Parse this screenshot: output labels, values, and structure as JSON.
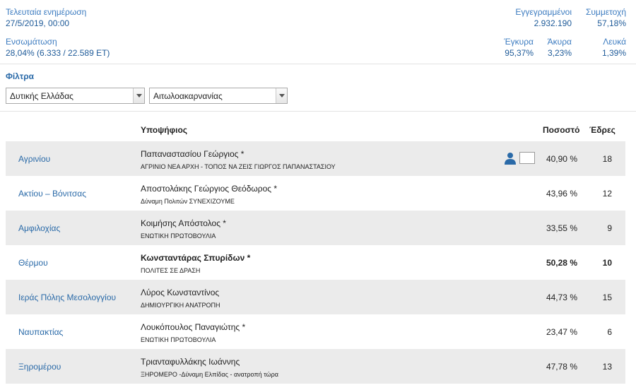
{
  "header": {
    "last_update_label": "Τελευταία ενημέρωση",
    "last_update_value": "27/5/2019, 00:00",
    "integration_label": "Ενσωμάτωση",
    "integration_value": "28,04% (6.333 / 22.589 ΕΤ)",
    "registered_label": "Εγγεγραμμένοι",
    "registered_value": "2.932.190",
    "turnout_label": "Συμμετοχή",
    "turnout_value": "57,18%",
    "valid_label": "Έγκυρα",
    "valid_value": "95,37%",
    "invalid_label": "Άκυρα",
    "invalid_value": "3,23%",
    "blank_label": "Λευκά",
    "blank_value": "1,39%"
  },
  "filters": {
    "title": "Φίλτρα",
    "region": "Δυτικής Ελλάδας",
    "unit": "Αιτωλοακαρνανίας"
  },
  "table": {
    "col_candidate": "Υποψήφιος",
    "col_percent": "Ποσοστό",
    "col_seats": "Έδρες",
    "rows": [
      {
        "municipality": "Αγρινίου",
        "candidate": "Παπαναστασίου Γεώργιος *",
        "party": "ΑΓΡΙΝΙΟ ΝΕΑ ΑΡΧΗ - ΤΟΠΟΣ ΝΑ ΖΕΙΣ ΓΙΩΡΓΟΣ ΠΑΠΑΝΑΣΤΑΣΙΟΥ",
        "percent": "40,90 %",
        "seats": "18"
      },
      {
        "municipality": "Ακτίου – Βόνιτσας",
        "candidate": "Αποστολάκης Γεώργιος Θεόδωρος *",
        "party": "Δύναμη Πολιτών ΣΥΝΕΧΙΖΟΥΜΕ",
        "percent": "43,96 %",
        "seats": "12"
      },
      {
        "municipality": "Αμφιλοχίας",
        "candidate": "Κοιμήσης Απόστολος *",
        "party": "ΕΝΩΤΙΚΗ ΠΡΩΤΟΒΟΥΛΙΑ",
        "percent": "33,55 %",
        "seats": "9"
      },
      {
        "municipality": "Θέρμου",
        "candidate": "Κωνσταντάρας Σπυρίδων *",
        "party": "ΠΟΛΙΤΕΣ ΣΕ ΔΡΑΣΗ",
        "percent": "50,28 %",
        "seats": "10"
      },
      {
        "municipality": "Ιεράς Πόλης Μεσολογγίου",
        "candidate": "Λύρος Κωνσταντίνος",
        "party": "ΔΗΜΙΟΥΡΓΙΚΗ ΑΝΑΤΡΟΠΗ",
        "percent": "44,73 %",
        "seats": "15"
      },
      {
        "municipality": "Ναυπακτίας",
        "candidate": "Λουκόπουλος Παναγιώτης *",
        "party": "ΕΝΩΤΙΚΗ ΠΡΩΤΟΒΟΥΛΙΑ",
        "percent": "23,47 %",
        "seats": "6"
      },
      {
        "municipality": "Ξηρομέρου",
        "candidate": "Τριανταφυλλάκης Ιωάννης",
        "party": "ΞΗΡΟΜΕΡΟ -Δύναμη Ελπίδας - ανατροπή τώρα",
        "percent": "47,78 %",
        "seats": "13"
      }
    ]
  }
}
